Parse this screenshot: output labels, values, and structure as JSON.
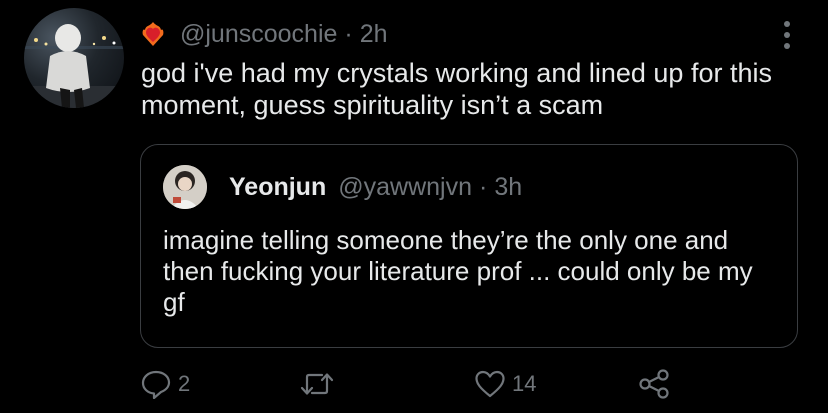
{
  "tweet": {
    "handle": "@junscoochie",
    "separator": "·",
    "time": "2h",
    "text": "god i've had my crystals working and lined up for this moment, guess spirituality isn’t a scam",
    "avatar_icon": "user-avatar-photo",
    "emoji_icon": "heart-on-fire-icon",
    "more_icon": "vertical-dots-icon"
  },
  "quoted": {
    "name": "Yeonjun",
    "handle": "@yawwnjvn",
    "separator": "·",
    "time": "3h",
    "text": "imagine telling someone they’re the only one and then fucking your literature prof ... could only be my gf",
    "avatar_icon": "quoted-user-avatar-photo"
  },
  "actions": {
    "reply_count": "2",
    "retweet_count": "",
    "like_count": "14",
    "reply_icon": "reply-icon",
    "retweet_icon": "retweet-icon",
    "like_icon": "heart-icon",
    "share_icon": "share-icon"
  },
  "colors": {
    "background": "#000000",
    "primary_text": "#e7e9ea",
    "secondary_text": "#71767b",
    "border": "#3a3d41"
  }
}
